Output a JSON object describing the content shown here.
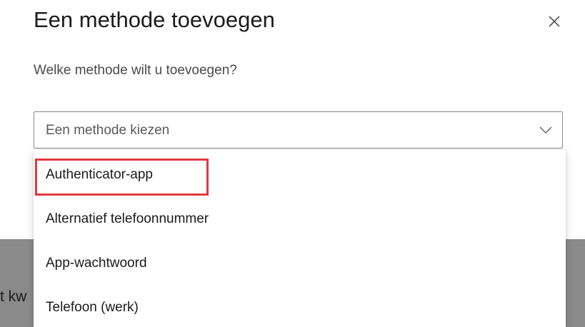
{
  "dialog": {
    "title": "Een methode toevoegen",
    "prompt": "Welke methode wilt u toevoegen?",
    "close_icon": "close-icon"
  },
  "method_select": {
    "value": "Een methode kiezen",
    "icon": "chevron-down-icon",
    "options": [
      {
        "label": "Authenticator-app",
        "highlighted": true
      },
      {
        "label": "Alternatief telefoonnummer"
      },
      {
        "label": "App-wachtwoord"
      },
      {
        "label": "Telefoon (werk)"
      }
    ]
  },
  "background_page": {
    "text": "t kw"
  },
  "colors": {
    "highlight": "#e0393e",
    "overlay": "#8a8a8a",
    "text": "#1b1b1b"
  }
}
